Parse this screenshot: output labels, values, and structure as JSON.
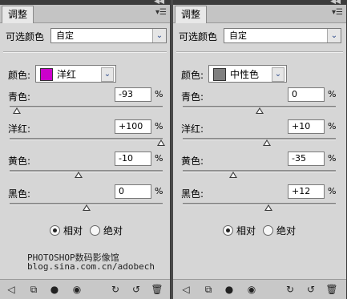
{
  "panels": [
    {
      "tab": "调整",
      "preset_label": "可选颜色",
      "preset_value": "自定",
      "colors_label": "颜色:",
      "color_name": "洋红",
      "color_swatch": "#cc00cc",
      "sliders": [
        {
          "label": "青色:",
          "value": "-93",
          "level_pct": -93
        },
        {
          "label": "洋红:",
          "value": "+100",
          "level_pct": 100
        },
        {
          "label": "黄色:",
          "value": "-10",
          "level_pct": -10
        },
        {
          "label": "黑色:",
          "value": "0",
          "level_pct": 0
        }
      ],
      "pct": "%",
      "radio_relative": "相对",
      "radio_absolute": "绝对",
      "relative_selected": true,
      "watermark_1": "PHOTOSHOP数码影像馆",
      "watermark_2": "blog.sina.com.cn/adobech"
    },
    {
      "tab": "调整",
      "preset_label": "可选颜色",
      "preset_value": "自定",
      "colors_label": "颜色:",
      "color_name": "中性色",
      "color_swatch": "#808080",
      "sliders": [
        {
          "label": "青色:",
          "value": "0",
          "level_pct": 0
        },
        {
          "label": "洋红:",
          "value": "+10",
          "level_pct": 10
        },
        {
          "label": "黄色:",
          "value": "-35",
          "level_pct": -35
        },
        {
          "label": "黑色:",
          "value": "+12",
          "level_pct": 12
        }
      ],
      "pct": "%",
      "radio_relative": "相对",
      "radio_absolute": "绝对",
      "relative_selected": true
    }
  ],
  "icons": {
    "collapse": "double-arrow-icon",
    "close": "close-icon",
    "menu": "panel-menu-icon",
    "toolbar": [
      "back-arrow-icon",
      "clip-layer-icon",
      "toggle-visibility-icon",
      "eye-icon",
      "view-previous-icon",
      "reset-icon",
      "trash-icon"
    ]
  }
}
